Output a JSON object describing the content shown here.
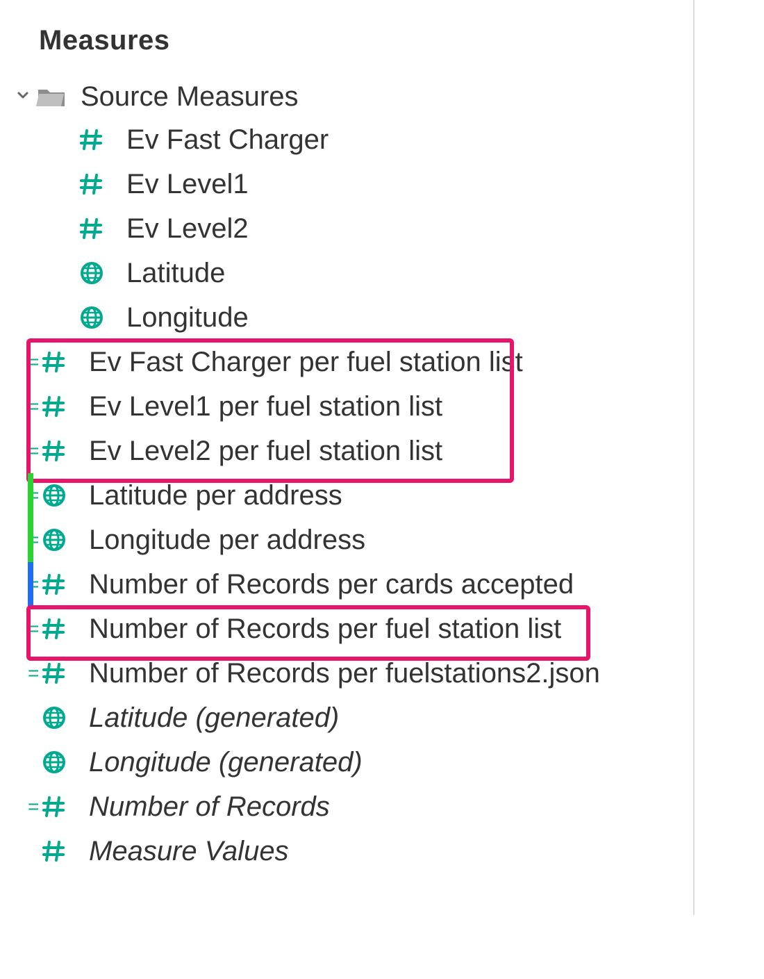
{
  "section_title": "Measures",
  "folder": {
    "label": "Source Measures"
  },
  "items": [
    {
      "label": "Ev Fast Charger",
      "icon": "hash",
      "nested": true,
      "italic": false
    },
    {
      "label": "Ev Level1",
      "icon": "hash",
      "nested": true,
      "italic": false
    },
    {
      "label": "Ev Level2",
      "icon": "hash",
      "nested": true,
      "italic": false
    },
    {
      "label": "Latitude",
      "icon": "globe",
      "nested": true,
      "italic": false
    },
    {
      "label": "Longitude",
      "icon": "globe",
      "nested": true,
      "italic": false
    },
    {
      "label": "Ev Fast Charger per fuel station list",
      "icon": "eq-hash",
      "nested": false,
      "italic": false
    },
    {
      "label": "Ev Level1 per fuel station list",
      "icon": "eq-hash",
      "nested": false,
      "italic": false
    },
    {
      "label": "Ev Level2 per fuel station list",
      "icon": "eq-hash",
      "nested": false,
      "italic": false
    },
    {
      "label": "Latitude per address",
      "icon": "eq-globe",
      "nested": false,
      "italic": false
    },
    {
      "label": "Longitude per address",
      "icon": "eq-globe",
      "nested": false,
      "italic": false
    },
    {
      "label": "Number of Records per cards accepted",
      "icon": "eq-hash",
      "nested": false,
      "italic": false
    },
    {
      "label": "Number of Records per fuel station list",
      "icon": "eq-hash",
      "nested": false,
      "italic": false
    },
    {
      "label": "Number of Records per fuelstations2.json",
      "icon": "eq-hash",
      "nested": false,
      "italic": false
    },
    {
      "label": "Latitude (generated)",
      "icon": "globe",
      "nested": false,
      "italic": true
    },
    {
      "label": "Longitude (generated)",
      "icon": "globe",
      "nested": false,
      "italic": true
    },
    {
      "label": "Number of Records",
      "icon": "eq-hash",
      "nested": false,
      "italic": true
    },
    {
      "label": "Measure Values",
      "icon": "hash",
      "nested": false,
      "italic": true
    }
  ],
  "annotations": {
    "pink_box_1": {
      "covers_items": [
        5,
        6,
        7
      ]
    },
    "green_bar": {
      "covers_items": [
        8,
        9
      ],
      "color": "#2bd233"
    },
    "blue_bar": {
      "covers_items": [
        10
      ],
      "color": "#1f6ef0"
    },
    "pink_box_2": {
      "covers_items": [
        11
      ]
    }
  },
  "colors": {
    "measure_icon": "#00a98f",
    "highlight_pink": "#e6156a"
  }
}
